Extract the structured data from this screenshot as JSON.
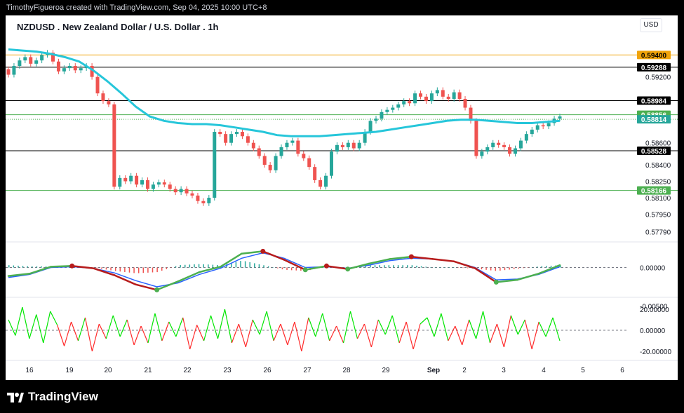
{
  "header": {
    "credit": "TimothyFigueroa created with TradingView.com, Sep 04, 2025 10:00 UTC+8"
  },
  "chart": {
    "title": "NZDUSD . New Zealand Dollar / U.S. Dollar . 1h",
    "currency": "USD"
  },
  "footer": {
    "brand": "TradingView"
  },
  "colors": {
    "up": "#26a69a",
    "down": "#ef5350",
    "ma": "#26c6da",
    "macd": "#2962ff",
    "signal_up": "#4caf50",
    "signal_down": "#b71c1c",
    "rsi_up": "#00e600",
    "rsi_down": "#ff2a2a"
  },
  "chart_data": [
    {
      "type": "candlestick",
      "title": "NZDUSD . New Zealand Dollar / U.S. Dollar . 1h",
      "x_ticks": [
        "16",
        "19",
        "20",
        "21",
        "22",
        "23",
        "26",
        "27",
        "28",
        "29",
        "Sep",
        "2",
        "3",
        "4",
        "5",
        "6"
      ],
      "y_ticks": [
        "0.59200",
        "0.58600",
        "0.58400",
        "0.58250",
        "0.58100",
        "0.57950",
        "0.57790"
      ],
      "ylim": [
        0.5773,
        0.596
      ],
      "price_lines": [
        {
          "value": "0.59400",
          "style": "orange"
        },
        {
          "value": "0.59288",
          "style": "black"
        },
        {
          "value": "0.58984",
          "style": "black"
        },
        {
          "value": "0.58856",
          "style": "green"
        },
        {
          "value": "0.58814",
          "style": "green-dotted"
        },
        {
          "value": "0.58528",
          "style": "black"
        },
        {
          "value": "0.58166",
          "style": "green"
        }
      ],
      "closes": [
        0.5922,
        0.593,
        0.5935,
        0.5938,
        0.5932,
        0.5935,
        0.594,
        0.5942,
        0.5934,
        0.5925,
        0.5928,
        0.593,
        0.5926,
        0.5928,
        0.593,
        0.592,
        0.5905,
        0.5898,
        0.5895,
        0.582,
        0.5828,
        0.5825,
        0.583,
        0.5822,
        0.5826,
        0.5818,
        0.5822,
        0.5824,
        0.5822,
        0.5818,
        0.5815,
        0.5818,
        0.5814,
        0.5812,
        0.5807,
        0.5805,
        0.581,
        0.587,
        0.5868,
        0.586,
        0.5868,
        0.587,
        0.5866,
        0.586,
        0.5855,
        0.5848,
        0.584,
        0.5835,
        0.5848,
        0.5856,
        0.586,
        0.5862,
        0.585,
        0.5846,
        0.5838,
        0.5826,
        0.582,
        0.583,
        0.5852,
        0.5858,
        0.5856,
        0.586,
        0.5855,
        0.586,
        0.587,
        0.588,
        0.5882,
        0.5888,
        0.589,
        0.5892,
        0.5895,
        0.5898,
        0.5896,
        0.5905,
        0.5902,
        0.5898,
        0.5905,
        0.5908,
        0.5902,
        0.59,
        0.5906,
        0.59,
        0.5892,
        0.588,
        0.5848,
        0.5852,
        0.5856,
        0.586,
        0.5858,
        0.5856,
        0.585,
        0.5855,
        0.5862,
        0.5868,
        0.5872,
        0.5876,
        0.5875,
        0.5878,
        0.5882,
        0.5884
      ],
      "moving_average": [
        0.5945,
        0.5944,
        0.5943,
        0.5941,
        0.5938,
        0.5934,
        0.5926,
        0.5916,
        0.5905,
        0.5893,
        0.5884,
        0.588,
        0.5878,
        0.5877,
        0.5877,
        0.5876,
        0.5874,
        0.5872,
        0.587,
        0.5867,
        0.5866,
        0.5866,
        0.5866,
        0.5867,
        0.5868,
        0.5869,
        0.587,
        0.5872,
        0.5874,
        0.5876,
        0.5878,
        0.588,
        0.5881,
        0.5881,
        0.588,
        0.5879,
        0.5878,
        0.5878,
        0.5879,
        0.588
      ],
      "series": [
        {
          "values": [
            -0.0011,
            -0.0008,
            0.0001,
            0.0002,
            -0.0001,
            -0.001,
            -0.0022,
            -0.0029,
            -0.0018,
            -0.0006,
            0.0001,
            0.0018,
            0.0021,
            0.001,
            -0.0003,
            0.0002,
            -0.0002,
            0.0005,
            0.0011,
            0.0014,
            0.0011,
            0.0008,
            -0.0001,
            -0.0019,
            -0.0016,
            -0.0008,
            0.0003
          ]
        },
        {
          "values": [
            -0.0013,
            -0.0009,
            0.0,
            0.0001,
            -0.0001,
            -0.0007,
            -0.0017,
            -0.0025,
            -0.002,
            -0.0009,
            -0.0001,
            0.0012,
            0.0019,
            0.0012,
            0.0,
            0.0001,
            -0.0001,
            0.0003,
            0.0009,
            0.0012,
            0.0011,
            0.0008,
            0.0,
            -0.0016,
            -0.0015,
            -0.0009,
            0.0001
          ]
        }
      ],
      "macd_ticks": [
        "0.00000",
        "-0.00500"
      ],
      "rsi_ticks": [
        "20.00000",
        "0.00000",
        "-20.00000"
      ],
      "rsi_values": [
        10,
        -5,
        22,
        -8,
        15,
        -12,
        18,
        5,
        -15,
        8,
        -10,
        12,
        -20,
        6,
        -8,
        14,
        -6,
        10,
        -14,
        4,
        -12,
        16,
        -10,
        8,
        -6,
        12,
        -18,
        5,
        -10,
        14,
        -8,
        20,
        -12,
        6,
        -16,
        10,
        -4,
        18,
        -10,
        6,
        -14,
        8,
        -20,
        12,
        -6,
        16,
        -10,
        4,
        -12,
        18,
        -8,
        6,
        -16,
        10,
        -4,
        14,
        -12,
        8,
        -18,
        6,
        12,
        -6,
        16,
        -10,
        4,
        -14,
        10,
        -8,
        18,
        -12,
        6,
        -16,
        14,
        -4,
        10,
        -18,
        8,
        -6,
        12,
        -10
      ]
    }
  ]
}
